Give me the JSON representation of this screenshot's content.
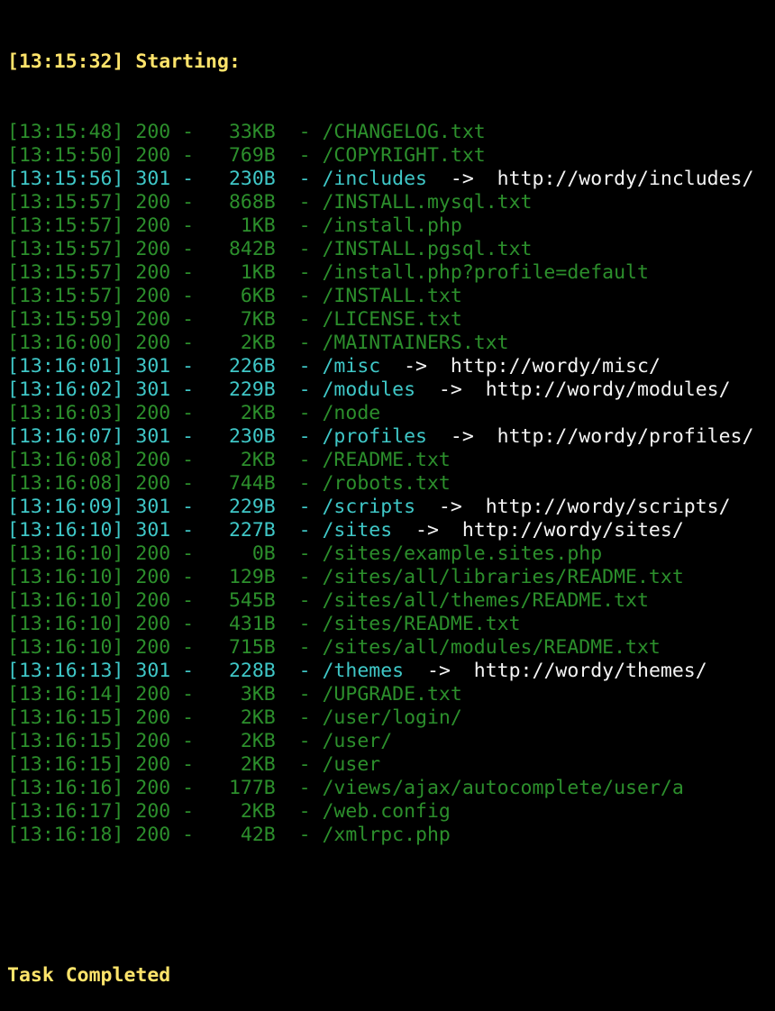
{
  "colors": {
    "background": "#000000",
    "header": "#ffe46b",
    "status_200": "#2c8f2c",
    "status_301": "#3fc7c7",
    "redirect_target": "#f4f4f4"
  },
  "header": "[13:15:32] Starting: ",
  "entries": [
    {
      "time": "[13:15:48]",
      "status": "200",
      "size": "  33KB",
      "path": "/CHANGELOG.txt",
      "redirect": ""
    },
    {
      "time": "[13:15:50]",
      "status": "200",
      "size": "  769B",
      "path": "/COPYRIGHT.txt",
      "redirect": ""
    },
    {
      "time": "[13:15:56]",
      "status": "301",
      "size": "  230B",
      "path": "/includes",
      "redirect": "http://wordy/includes/"
    },
    {
      "time": "[13:15:57]",
      "status": "200",
      "size": "  868B",
      "path": "/INSTALL.mysql.txt",
      "redirect": ""
    },
    {
      "time": "[13:15:57]",
      "status": "200",
      "size": "   1KB",
      "path": "/install.php",
      "redirect": ""
    },
    {
      "time": "[13:15:57]",
      "status": "200",
      "size": "  842B",
      "path": "/INSTALL.pgsql.txt",
      "redirect": ""
    },
    {
      "time": "[13:15:57]",
      "status": "200",
      "size": "   1KB",
      "path": "/install.php?profile=default",
      "redirect": ""
    },
    {
      "time": "[13:15:57]",
      "status": "200",
      "size": "   6KB",
      "path": "/INSTALL.txt",
      "redirect": ""
    },
    {
      "time": "[13:15:59]",
      "status": "200",
      "size": "   7KB",
      "path": "/LICENSE.txt",
      "redirect": ""
    },
    {
      "time": "[13:16:00]",
      "status": "200",
      "size": "   2KB",
      "path": "/MAINTAINERS.txt",
      "redirect": ""
    },
    {
      "time": "[13:16:01]",
      "status": "301",
      "size": "  226B",
      "path": "/misc",
      "redirect": "http://wordy/misc/"
    },
    {
      "time": "[13:16:02]",
      "status": "301",
      "size": "  229B",
      "path": "/modules",
      "redirect": "http://wordy/modules/"
    },
    {
      "time": "[13:16:03]",
      "status": "200",
      "size": "   2KB",
      "path": "/node",
      "redirect": ""
    },
    {
      "time": "[13:16:07]",
      "status": "301",
      "size": "  230B",
      "path": "/profiles",
      "redirect": "http://wordy/profiles/"
    },
    {
      "time": "[13:16:08]",
      "status": "200",
      "size": "   2KB",
      "path": "/README.txt",
      "redirect": ""
    },
    {
      "time": "[13:16:08]",
      "status": "200",
      "size": "  744B",
      "path": "/robots.txt",
      "redirect": ""
    },
    {
      "time": "[13:16:09]",
      "status": "301",
      "size": "  229B",
      "path": "/scripts",
      "redirect": "http://wordy/scripts/"
    },
    {
      "time": "[13:16:10]",
      "status": "301",
      "size": "  227B",
      "path": "/sites",
      "redirect": "http://wordy/sites/"
    },
    {
      "time": "[13:16:10]",
      "status": "200",
      "size": "    0B",
      "path": "/sites/example.sites.php",
      "redirect": ""
    },
    {
      "time": "[13:16:10]",
      "status": "200",
      "size": "  129B",
      "path": "/sites/all/libraries/README.txt",
      "redirect": ""
    },
    {
      "time": "[13:16:10]",
      "status": "200",
      "size": "  545B",
      "path": "/sites/all/themes/README.txt",
      "redirect": ""
    },
    {
      "time": "[13:16:10]",
      "status": "200",
      "size": "  431B",
      "path": "/sites/README.txt",
      "redirect": ""
    },
    {
      "time": "[13:16:10]",
      "status": "200",
      "size": "  715B",
      "path": "/sites/all/modules/README.txt",
      "redirect": ""
    },
    {
      "time": "[13:16:13]",
      "status": "301",
      "size": "  228B",
      "path": "/themes",
      "redirect": "http://wordy/themes/"
    },
    {
      "time": "[13:16:14]",
      "status": "200",
      "size": "   3KB",
      "path": "/UPGRADE.txt",
      "redirect": ""
    },
    {
      "time": "[13:16:15]",
      "status": "200",
      "size": "   2KB",
      "path": "/user/login/",
      "redirect": ""
    },
    {
      "time": "[13:16:15]",
      "status": "200",
      "size": "   2KB",
      "path": "/user/",
      "redirect": ""
    },
    {
      "time": "[13:16:15]",
      "status": "200",
      "size": "   2KB",
      "path": "/user",
      "redirect": ""
    },
    {
      "time": "[13:16:16]",
      "status": "200",
      "size": "  177B",
      "path": "/views/ajax/autocomplete/user/a",
      "redirect": ""
    },
    {
      "time": "[13:16:17]",
      "status": "200",
      "size": "   2KB",
      "path": "/web.config",
      "redirect": ""
    },
    {
      "time": "[13:16:18]",
      "status": "200",
      "size": "   42B",
      "path": "/xmlrpc.php",
      "redirect": ""
    }
  ],
  "footer": "Task Completed"
}
